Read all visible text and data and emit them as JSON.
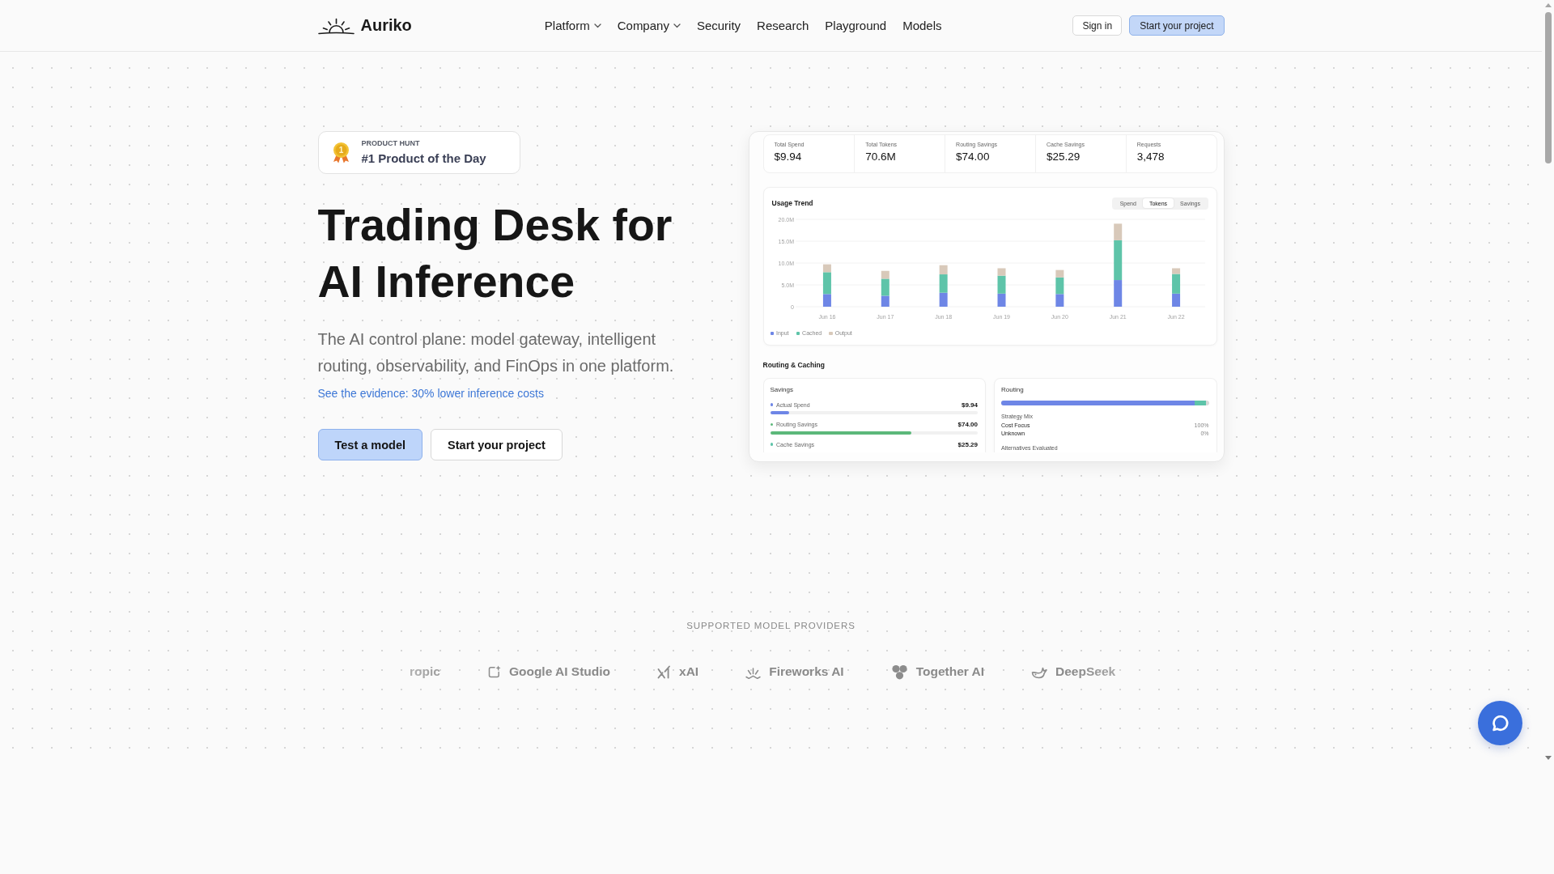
{
  "header": {
    "logo": "Auriko",
    "nav": [
      {
        "label": "Platform",
        "dropdown": true
      },
      {
        "label": "Company",
        "dropdown": true
      },
      {
        "label": "Security",
        "dropdown": false
      },
      {
        "label": "Research",
        "dropdown": false
      },
      {
        "label": "Playground",
        "dropdown": false
      },
      {
        "label": "Models",
        "dropdown": false
      }
    ],
    "actions": [
      {
        "label": "Sign in",
        "kind": "secondary"
      },
      {
        "label": "Start your project",
        "kind": "primary"
      }
    ]
  },
  "hero": {
    "badge": {
      "medal": "1",
      "eyebrow": "PRODUCT HUNT",
      "title": "#1 Product of the Day"
    },
    "title": "Trading Desk for AI Inference",
    "subtitle": "The AI control plane: model gateway, intelligent routing, observability, and FinOps in one platform.",
    "link": "See the evidence: 30% lower inference costs",
    "buttons": [
      {
        "label": "Test a model",
        "kind": "primary"
      },
      {
        "label": "Start your project",
        "kind": "secondary"
      }
    ]
  },
  "dashboard": {
    "stats": [
      {
        "label": "Total Spend",
        "value": "$9.94"
      },
      {
        "label": "Total Tokens",
        "value": "70.6M"
      },
      {
        "label": "Routing Savings",
        "value": "$74.00"
      },
      {
        "label": "Cache Savings",
        "value": "$25.29"
      },
      {
        "label": "Requests",
        "value": "3,478"
      }
    ],
    "usage_trend": {
      "title": "Usage Trend",
      "toggles": [
        {
          "label": "Spend",
          "selected": false
        },
        {
          "label": "Tokens",
          "selected": true
        },
        {
          "label": "Savings",
          "selected": false
        }
      ],
      "chart_data": {
        "type": "bar",
        "stacked": true,
        "grid": true,
        "categories": [
          "Jun 16",
          "Jun 17",
          "Jun 18",
          "Jun 19",
          "Jun 20",
          "Jun 21",
          "Jun 22"
        ],
        "series": [
          {
            "name": "Input",
            "color": "#6e86e6",
            "values": [
              2.9,
              2.5,
              3.2,
              3.0,
              2.9,
              6.1,
              3.0
            ]
          },
          {
            "name": "Cached",
            "color": "#5ec4a9",
            "values": [
              5.0,
              3.9,
              4.2,
              4.1,
              3.8,
              9.1,
              4.5
            ]
          },
          {
            "name": "Output",
            "color": "#d8c9ba",
            "values": [
              1.8,
              1.8,
              2.1,
              1.7,
              1.7,
              3.8,
              1.3
            ]
          }
        ],
        "ylim": [
          0,
          20
        ],
        "yticks": [
          {
            "value": 0,
            "label": "0"
          },
          {
            "value": 5,
            "label": "5.0M"
          },
          {
            "value": 10,
            "label": "10.0M"
          },
          {
            "value": 15,
            "label": "15.0M"
          },
          {
            "value": 20,
            "label": "20.0M"
          }
        ]
      }
    },
    "routing_caching": {
      "title": "Routing & Caching",
      "savings": {
        "title": "Savings",
        "items": [
          {
            "label": "Actual Spend",
            "value": "$9.94",
            "color": "#6e86e6",
            "level": 0.09
          },
          {
            "label": "Routing Savings",
            "value": "$74.00",
            "color": "#5cb87a",
            "level": 0.68
          },
          {
            "label": "Cache Savings",
            "value": "$25.29",
            "color": "#5ec4a9"
          }
        ]
      },
      "routing": {
        "title": "Routing",
        "segments": [
          {
            "color": "#6e86e6",
            "level": 0.93
          },
          {
            "color": "#5ec4a9",
            "level": 0.055
          }
        ],
        "strategy_title": "Strategy Mix",
        "strategies": [
          {
            "label": "Cost Focus",
            "value": "100%"
          },
          {
            "label": "Unknown",
            "value": "0%"
          }
        ],
        "alternatives_title": "Alternatives Evaluated"
      }
    }
  },
  "providers": {
    "title": "SUPPORTED MODEL PROVIDERS",
    "items": [
      {
        "name": "ropic",
        "kind": "clipped"
      },
      {
        "name": "Google AI Studio",
        "kind": "sparkle"
      },
      {
        "name": "xAI",
        "kind": "slash"
      },
      {
        "name": "Fireworks AI",
        "kind": "rays"
      },
      {
        "name": "Together AI",
        "kind": "circles"
      },
      {
        "name": "DeepSeek",
        "kind": "whale"
      }
    ]
  }
}
